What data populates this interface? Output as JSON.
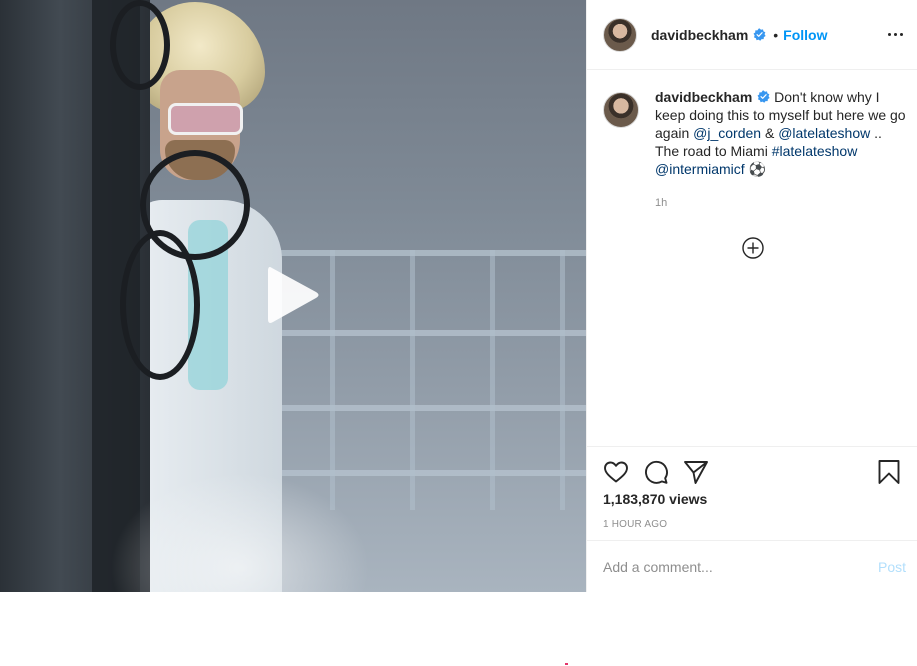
{
  "colors": {
    "accent_link": "#0095f6",
    "mention": "#00376b",
    "secondary_text": "#8e8e8e",
    "post_disabled": "#b2dffc"
  },
  "header": {
    "username": "davidbeckham",
    "separator": "•",
    "follow_label": "Follow",
    "more_icon": "more-horizontal-icon"
  },
  "caption": {
    "username": "davidbeckham",
    "text_1": "Don't know why I keep doing this to myself but here we go again ",
    "mention_1": "@j_corden",
    "amp": " & ",
    "mention_2": "@latelateshow",
    "text_2": " .. The road to Miami ",
    "hashtag": "#latelateshow",
    "mention_3": "@intermiamicf",
    "emoji": " ⚽",
    "time": "1h"
  },
  "media": {
    "play_icon": "play-icon"
  },
  "actions": {
    "like_icon": "heart-icon",
    "comment_icon": "comment-icon",
    "share_icon": "send-icon",
    "save_icon": "bookmark-icon",
    "views": "1,183,870 views",
    "time_ago": "1 HOUR AGO"
  },
  "comment": {
    "placeholder": "Add a comment...",
    "post_label": "Post"
  }
}
